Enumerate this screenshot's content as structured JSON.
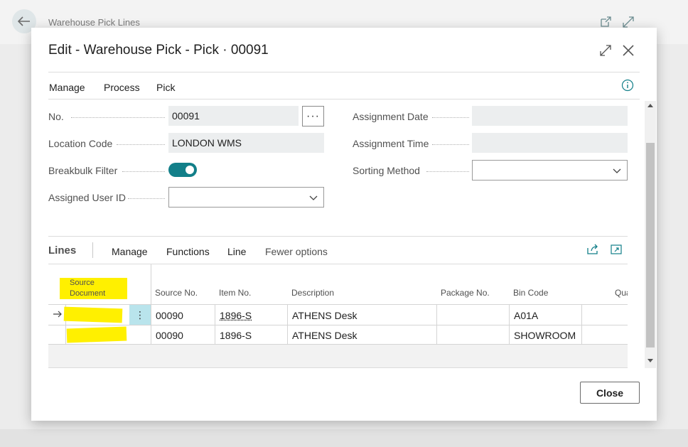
{
  "background": {
    "page_title": "Warehouse Pick Lines"
  },
  "dialog": {
    "title": "Edit - Warehouse Pick - Pick · 00091",
    "menu": [
      "Manage",
      "Process",
      "Pick"
    ],
    "close_label": "Close"
  },
  "fields": {
    "no": {
      "label": "No.",
      "value": "00091"
    },
    "location_code": {
      "label": "Location Code",
      "value": "LONDON WMS"
    },
    "breakbulk_filter": {
      "label": "Breakbulk Filter",
      "value": "on"
    },
    "assigned_user_id": {
      "label": "Assigned User ID",
      "value": ""
    },
    "assignment_date": {
      "label": "Assignment Date",
      "value": ""
    },
    "assignment_time": {
      "label": "Assignment Time",
      "value": ""
    },
    "sorting_method": {
      "label": "Sorting Method",
      "value": ""
    }
  },
  "lines": {
    "title": "Lines",
    "actions": [
      "Manage",
      "Functions",
      "Line",
      "Fewer options"
    ],
    "columns": [
      "Source Document",
      "Source No.",
      "Item No.",
      "Description",
      "Package No.",
      "Bin Code",
      "Qua"
    ],
    "rows": [
      {
        "source_no": "00090",
        "item_no": "1896-S",
        "description": "ATHENS Desk",
        "package_no": "",
        "bin_code": "A01A"
      },
      {
        "source_no": "00090",
        "item_no": "1896-S",
        "description": "ATHENS Desk",
        "package_no": "",
        "bin_code": "SHOWROOM"
      }
    ]
  },
  "colors": {
    "accent": "#127f89",
    "highlight": "#fff000",
    "row_menu": "#b9e4ec"
  }
}
